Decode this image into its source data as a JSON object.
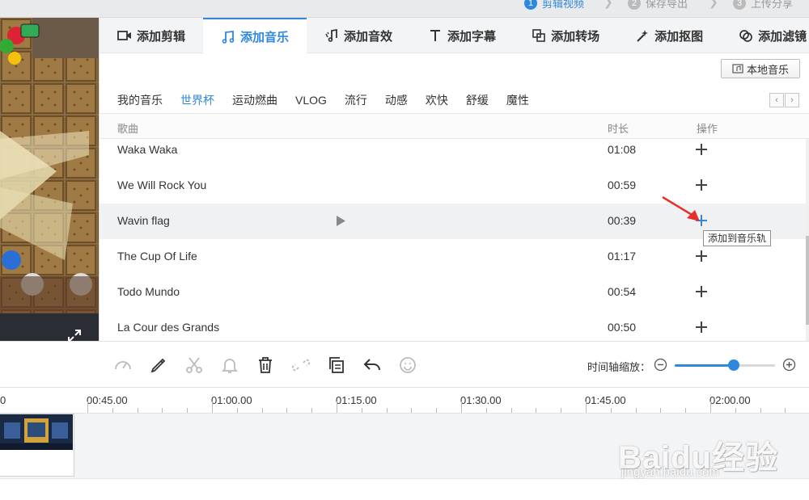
{
  "steps": [
    {
      "num": "1",
      "label": "剪辑视频"
    },
    {
      "num": "2",
      "label": "保存导出"
    },
    {
      "num": "3",
      "label": "上传分享"
    }
  ],
  "tabs": [
    {
      "label": "添加剪辑",
      "icon": "video-camera-icon"
    },
    {
      "label": "添加音乐",
      "icon": "music-note-icon"
    },
    {
      "label": "添加音效",
      "icon": "sound-effect-icon"
    },
    {
      "label": "添加字幕",
      "icon": "text-icon"
    },
    {
      "label": "添加转场",
      "icon": "transition-icon"
    },
    {
      "label": "添加抠图",
      "icon": "magic-wand-icon"
    },
    {
      "label": "添加滤镜",
      "icon": "filter-icon"
    }
  ],
  "local_music_label": "本地音乐",
  "categories": [
    "我的音乐",
    "世界杯",
    "运动燃曲",
    "VLOG",
    "流行",
    "动感",
    "欢快",
    "舒缓",
    "魔性"
  ],
  "active_category": "世界杯",
  "columns": {
    "song": "歌曲",
    "duration": "时长",
    "action": "操作"
  },
  "songs": [
    {
      "title": "Waka Waka",
      "duration": "01:08"
    },
    {
      "title": "We Will Rock You",
      "duration": "00:59"
    },
    {
      "title": "Wavin flag",
      "duration": "00:39"
    },
    {
      "title": "The Cup Of Life",
      "duration": "01:17"
    },
    {
      "title": "Todo Mundo",
      "duration": "00:54"
    },
    {
      "title": "La Cour des Grands",
      "duration": "00:50"
    }
  ],
  "tooltip": "添加到音乐轨",
  "zoom": {
    "label": "时间轴缩放：",
    "level": 0.59
  },
  "timeline_ticks": [
    "0",
    "00:45.00",
    "01:00.00",
    "01:15.00",
    "01:30.00",
    "01:45.00",
    "02:00.00"
  ],
  "watermark": {
    "logo": "Baidu经验",
    "url": "jingyan.baidu.com"
  },
  "colors": {
    "accent": "#2f88e0",
    "annotation_arrow": "#e8302a"
  }
}
